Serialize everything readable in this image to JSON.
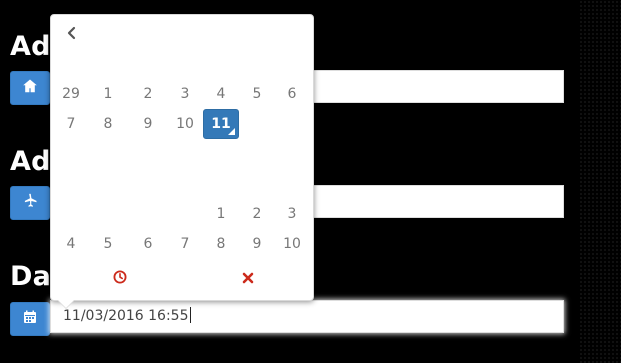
{
  "labels": {
    "section_1": "Adr",
    "section_2": "Adr",
    "section_3": "Dat"
  },
  "date_field": {
    "value": "11/03/2016 16:55"
  },
  "picker": {
    "month_rows": {
      "row_1": [
        "29",
        "1",
        "2",
        "3",
        "4",
        "5",
        "6"
      ],
      "row_2": [
        "7",
        "8",
        "9",
        "10",
        "11"
      ],
      "row_3": [
        "1",
        "2",
        "3"
      ],
      "row_4": [
        "4",
        "5",
        "6",
        "7",
        "8",
        "9",
        "10"
      ]
    },
    "selected_day": "11"
  },
  "icons": {
    "prev": "chevron-left-icon",
    "home": "home-icon",
    "plane": "plane-icon",
    "calendar": "calendar-icon",
    "clock": "clock-icon",
    "close": "close-icon"
  },
  "colors": {
    "accent": "#3d86d1",
    "selected": "#3479b8",
    "danger": "#cc2a1b"
  }
}
